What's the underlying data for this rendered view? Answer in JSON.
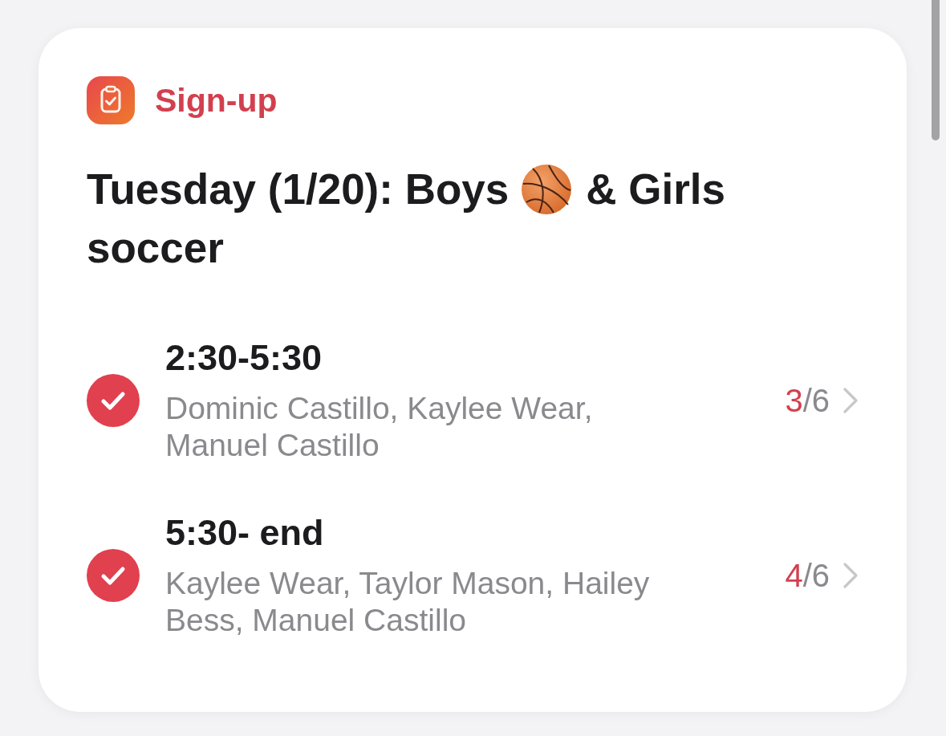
{
  "header": {
    "label": "Sign-up"
  },
  "title": {
    "before_emoji": "Tuesday (1/20): Boys",
    "after_emoji": "& Girls",
    "second_line": "soccer"
  },
  "slots": [
    {
      "time": "2:30-5:30",
      "names": "Dominic Castillo, Kaylee Wear, Manuel Castillo",
      "checked": true,
      "taken": "3",
      "capacity": "/6"
    },
    {
      "time": "5:30- end",
      "names": "Kaylee Wear, Taylor Mason, Hailey Bess, Manuel Castillo",
      "checked": true,
      "taken": "4",
      "capacity": "/6"
    }
  ]
}
